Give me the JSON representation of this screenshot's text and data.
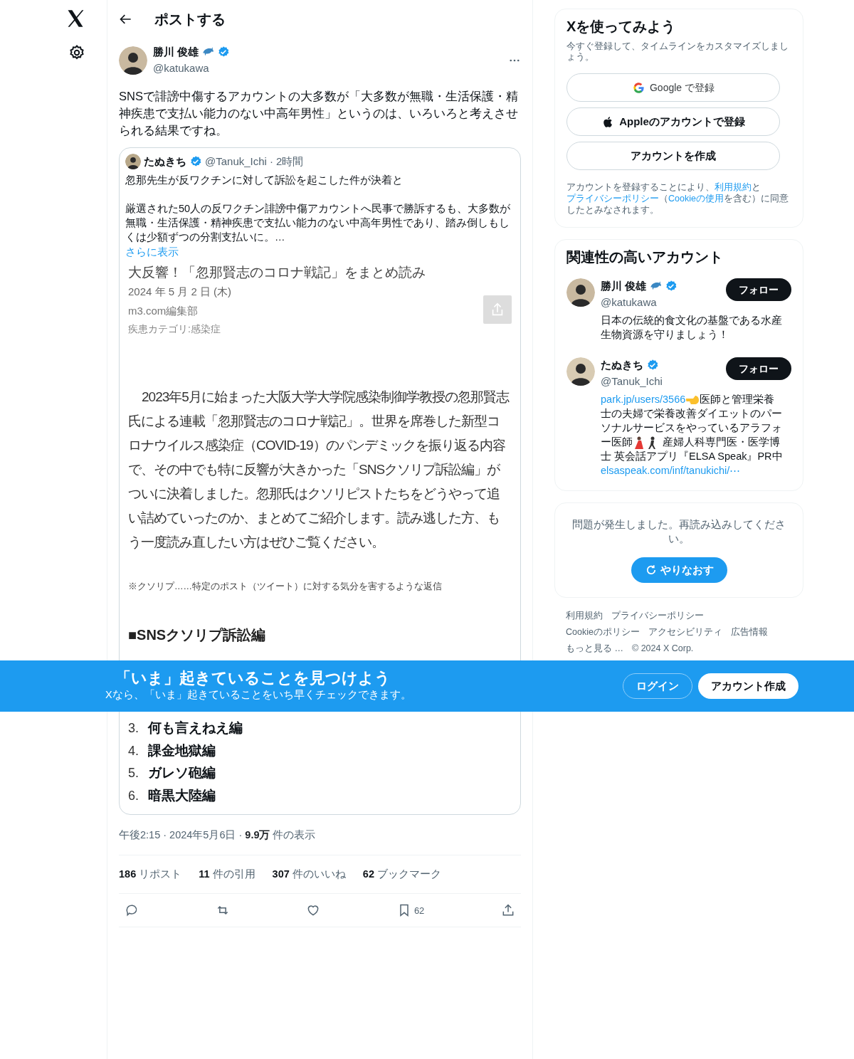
{
  "header": {
    "title": "ポストする"
  },
  "post": {
    "author": {
      "name": "勝川 俊雄",
      "handle": "@katukawa",
      "verified": true,
      "emoji": true
    },
    "text": "SNSで誹謗中傷するアカウントの大多数が「大多数が無職・生活保護・精神疾患で支払い能力のない中高年男性」というのは、いろいろと考えさせられる結果ですね。",
    "quote": {
      "author": {
        "name": "たぬきち",
        "handle": "@Tanuk_Ichi",
        "verified": true
      },
      "separator": "·",
      "time": "2時間",
      "paragraphs": [
        "忽那先生が反ワクチンに対して訴訟を起こした件が決着と",
        "厳選された50人の反ワクチン誹謗中傷アカウントへ民事で勝訴するも、大多数が無職・生活保護・精神疾患で支払い能力のない中高年男性であり、踏み倒しもしくは少額ずつの分割支払いに。…"
      ],
      "show_more": "さらに表示",
      "article": {
        "title": "大反響！「忽那賢志のコロナ戦記」をまとめ読み",
        "date": "2024 年 5 月 2 日 (木)",
        "source": "m3.com編集部",
        "category": "疾患カテゴリ:感染症",
        "body": "2023年5月に始まった大阪大学大学院感染制御学教授の忽那賢志氏による連載「忽那賢志のコロナ戦記」。世界を席巻した新型コロナウイルス感染症（COVID-19）のパンデミックを振り返る内容で、その中でも特に反響が大きかった「SNSクソリプ訴訟編」がついに決着しました。忽那氏はクソリピストたちをどうやって追い詰めていったのか、まとめてご紹介します。読み逃した方、もう一度読み直したい方はぜひご覧ください。",
        "note": "※クソリプ……特定のポスト（ツイート）に対する気分を害するような返信",
        "heading": "■SNSクソリプ訴訟編",
        "list": [
          {
            "number": "3.",
            "title": "何も言えねえ編"
          },
          {
            "number": "4.",
            "title": "課金地獄編"
          },
          {
            "number": "5.",
            "title": "ガレソ砲編"
          },
          {
            "number": "6.",
            "title": "暗黒大陸編"
          }
        ]
      }
    },
    "time": "午後2:15",
    "separators": [
      "·",
      "·"
    ],
    "date": "2024年5月6日",
    "views_count": "9.9万",
    "views_label": "件の表示",
    "stats": [
      {
        "count": "186",
        "label": "リポスト"
      },
      {
        "count": "11",
        "label": "件の引用"
      },
      {
        "count": "307",
        "label": "件のいいね"
      },
      {
        "count": "62",
        "label": "ブックマーク"
      }
    ],
    "actions": [
      {
        "kind": "reply"
      },
      {
        "kind": "repost"
      },
      {
        "kind": "like"
      },
      {
        "kind": "bookmark",
        "count": "62"
      },
      {
        "kind": "share"
      }
    ]
  },
  "signup": {
    "title": "Xを使ってみよう",
    "subtitle": "今すぐ登録して、タイムラインをカスタマイズしましょう。",
    "buttons": [
      {
        "kind": "google",
        "label": "Google で登録"
      },
      {
        "kind": "apple",
        "label": "Appleのアカウントで登録"
      },
      {
        "kind": "plain",
        "label": "アカウントを作成"
      }
    ],
    "legal": [
      {
        "kind": "text",
        "text": "アカウントを登録することにより、"
      },
      {
        "kind": "link",
        "text": "利用規約"
      },
      {
        "kind": "text",
        "text": "と"
      },
      {
        "kind": "link",
        "text": "プライバシーポリシー"
      },
      {
        "kind": "text",
        "text": "（"
      },
      {
        "kind": "link",
        "text": "Cookieの使用"
      },
      {
        "kind": "text",
        "text": "を含む）に同意したとみなされます。"
      }
    ]
  },
  "relevant": {
    "title": "関連性の高いアカウント",
    "accounts": [
      {
        "name": "勝川 俊雄",
        "handle": "@katukawa",
        "verified": true,
        "emoji": true,
        "follow": "フォロー",
        "bio": [
          {
            "kind": "text",
            "text": "日本の伝統的食文化の基盤である水産生物資源を守りましょう！"
          }
        ]
      },
      {
        "name": "たぬきち",
        "handle": "@Tanuk_Ichi",
        "verified": true,
        "follow": "フォロー",
        "bio": [
          {
            "kind": "link",
            "text": "park.jp/users/3566"
          },
          {
            "kind": "hand"
          },
          {
            "kind": "text",
            "text": "医師と管理栄養士の夫婦で栄養改善ダイエットのパーソナルサービスをやっているアラフォー医師"
          },
          {
            "kind": "dancers"
          },
          {
            "kind": "text",
            "text": " 産婦人科専門医・医学博士 英会話アプリ『ELSA Speak』PR中"
          },
          {
            "kind": "link",
            "text": "elsaspeak.com/inf/tanukichi/⋯"
          }
        ]
      }
    ]
  },
  "error_card": {
    "message": "問題が発生しました。再読み込みしてください。",
    "retry": "やりなおす"
  },
  "footer_links": [
    "利用規約",
    "プライバシーポリシー",
    "Cookieのポリシー",
    "アクセシビリティ",
    "広告情報",
    "もっと見る …",
    "© 2024 X Corp."
  ],
  "banner": {
    "title": "「いま」起きていることを見つけよう",
    "subtitle": "Xなら、「いま」起きていることをいち早くチェックできます。",
    "login": "ログイン",
    "signup": "アカウント作成"
  }
}
